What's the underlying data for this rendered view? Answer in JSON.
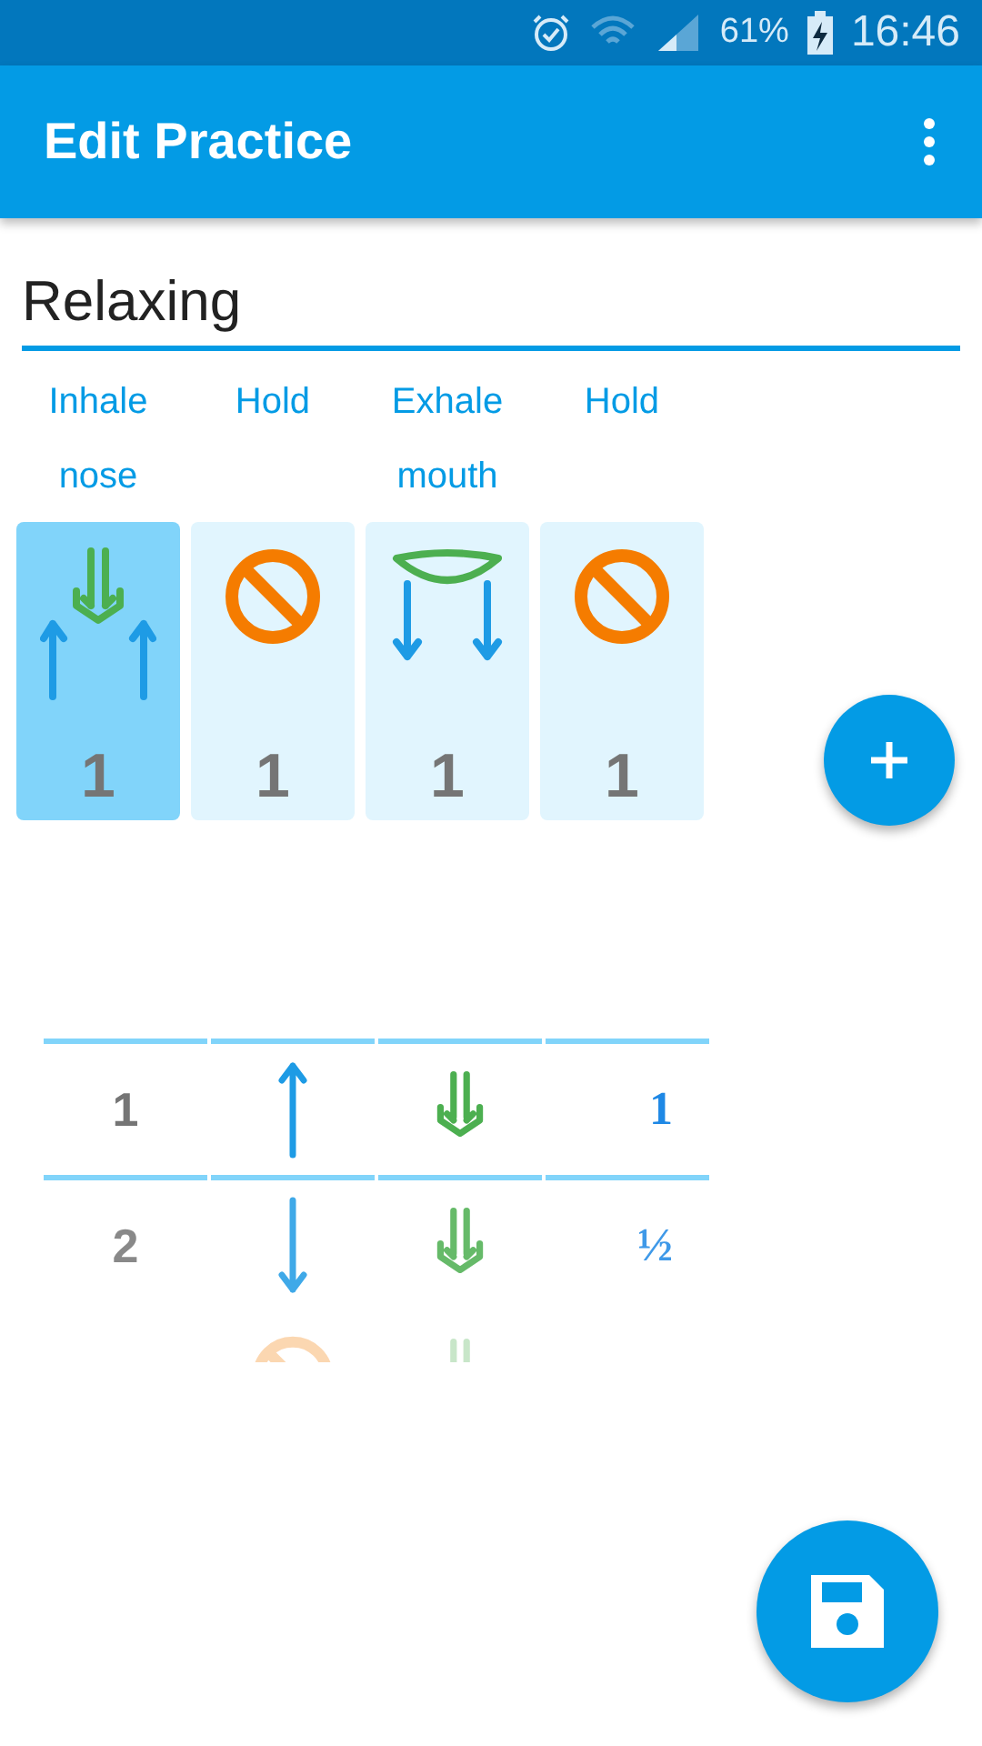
{
  "status_bar": {
    "battery": "61%",
    "time": "16:46"
  },
  "app_bar": {
    "title": "Edit Practice"
  },
  "practice_name": {
    "value": "Relaxing"
  },
  "phases": [
    {
      "label": "Inhale",
      "sublabel": "nose",
      "kind": "inhale_nose",
      "count": "1",
      "selected": true
    },
    {
      "label": "Hold",
      "kind": "hold",
      "count": "1",
      "selected": false
    },
    {
      "label": "Exhale",
      "sublabel": "mouth",
      "kind": "exhale_mouth",
      "count": "1",
      "selected": false
    },
    {
      "label": "Hold",
      "kind": "hold",
      "count": "1",
      "selected": false
    }
  ],
  "picker_rows": [
    {
      "number": "1",
      "kind": "up",
      "fraction": "1"
    },
    {
      "number": "2",
      "kind": "down",
      "fraction": "½"
    },
    {
      "kind": "hold"
    }
  ]
}
